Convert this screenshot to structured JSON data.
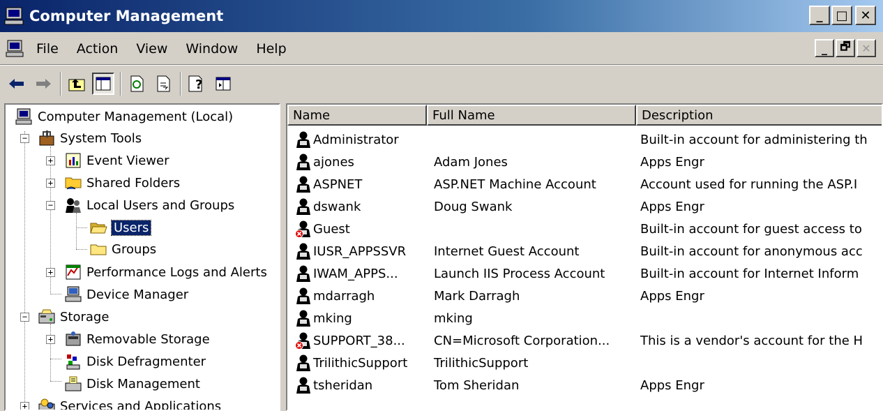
{
  "window": {
    "title": "Computer Management",
    "caption_buttons": {
      "minimize": "_",
      "maximize": "□",
      "close": "✕"
    }
  },
  "menu": {
    "items": [
      "File",
      "Action",
      "View",
      "Window",
      "Help"
    ],
    "mdi_buttons": {
      "minimize": "_",
      "restore": "🗗",
      "close": "✕"
    }
  },
  "toolbar": {
    "buttons": [
      "back-arrow-icon",
      "forward-arrow-icon",
      "up-one-level-icon",
      "show-hide-tree-icon",
      "refresh-icon",
      "export-list-icon",
      "help-icon",
      "show-hide-action-pane-icon"
    ]
  },
  "tree": {
    "root": "Computer Management (Local)",
    "system_tools": "System Tools",
    "event_viewer": "Event Viewer",
    "shared_folders": "Shared Folders",
    "local_users_groups": "Local Users and Groups",
    "users": "Users",
    "groups": "Groups",
    "perf_logs": "Performance Logs and Alerts",
    "device_manager": "Device Manager",
    "storage": "Storage",
    "removable_storage": "Removable Storage",
    "disk_defrag": "Disk Defragmenter",
    "disk_management": "Disk Management",
    "services_apps": "Services and Applications"
  },
  "list": {
    "columns": [
      "Name",
      "Full Name",
      "Description"
    ],
    "rows": [
      {
        "name": "Administrator",
        "full_name": "",
        "description": "Built-in account for administering th",
        "disabled": false
      },
      {
        "name": "ajones",
        "full_name": "Adam Jones",
        "description": "Apps Engr",
        "disabled": false
      },
      {
        "name": "ASPNET",
        "full_name": "ASP.NET Machine Account",
        "description": "Account used for running the ASP.I",
        "disabled": false
      },
      {
        "name": "dswank",
        "full_name": "Doug Swank",
        "description": "Apps Engr",
        "disabled": false
      },
      {
        "name": "Guest",
        "full_name": "",
        "description": "Built-in account for guest access to",
        "disabled": true
      },
      {
        "name": "IUSR_APPSSVR",
        "full_name": "Internet Guest Account",
        "description": "Built-in account for anonymous acc",
        "disabled": false
      },
      {
        "name": "IWAM_APPS...",
        "full_name": "Launch IIS Process Account",
        "description": "Built-in account for Internet Inform",
        "disabled": false
      },
      {
        "name": "mdarragh",
        "full_name": "Mark Darragh",
        "description": "Apps Engr",
        "disabled": false
      },
      {
        "name": "mking",
        "full_name": "mking",
        "description": "",
        "disabled": false
      },
      {
        "name": "SUPPORT_38...",
        "full_name": "CN=Microsoft Corporation...",
        "description": "This is a vendor's account for the H",
        "disabled": true
      },
      {
        "name": "TrilithicSupport",
        "full_name": "TrilithicSupport",
        "description": "",
        "disabled": false
      },
      {
        "name": "tsheridan",
        "full_name": "Tom Sheridan",
        "description": "Apps Engr",
        "disabled": false
      }
    ]
  },
  "colors": {
    "title_bar": "#0a246a",
    "face": "#d4d0c8",
    "selection": "#0a246a"
  }
}
